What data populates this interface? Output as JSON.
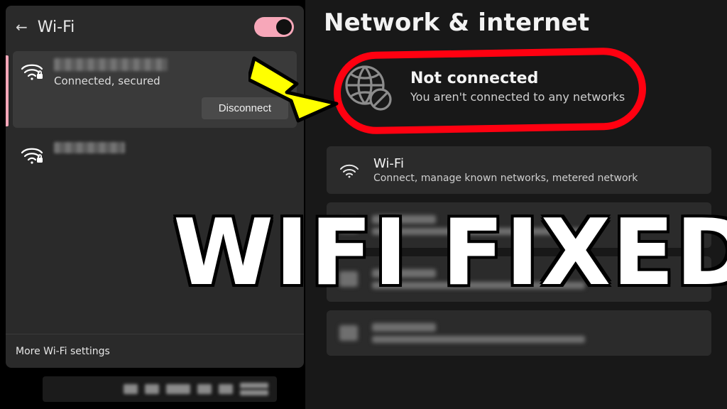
{
  "wifi_flyout": {
    "title": "Wi-Fi",
    "toggle_on": true,
    "networks": [
      {
        "status": "Connected, secured",
        "disconnect_label": "Disconnect",
        "selected": true
      },
      {
        "status": "",
        "selected": false
      }
    ],
    "more_label": "More Wi-Fi settings"
  },
  "settings": {
    "title": "Network & internet",
    "not_connected": {
      "heading": "Not connected",
      "sub": "You aren't connected to any networks"
    },
    "wifi_card": {
      "title": "Wi-Fi",
      "sub": "Connect, manage known networks, metered network"
    }
  },
  "overlay": {
    "caption": "WIFI FIXED"
  },
  "icons": {
    "back": "back-arrow-icon",
    "wifi": "wifi-icon",
    "wifi_locked": "wifi-locked-icon",
    "globe_off": "globe-disconnected-icon",
    "toggle": "wifi-toggle"
  },
  "colors": {
    "accent": "#f7a7b9",
    "highlight_ring": "#ff0010",
    "arrow": "#ffff00"
  }
}
